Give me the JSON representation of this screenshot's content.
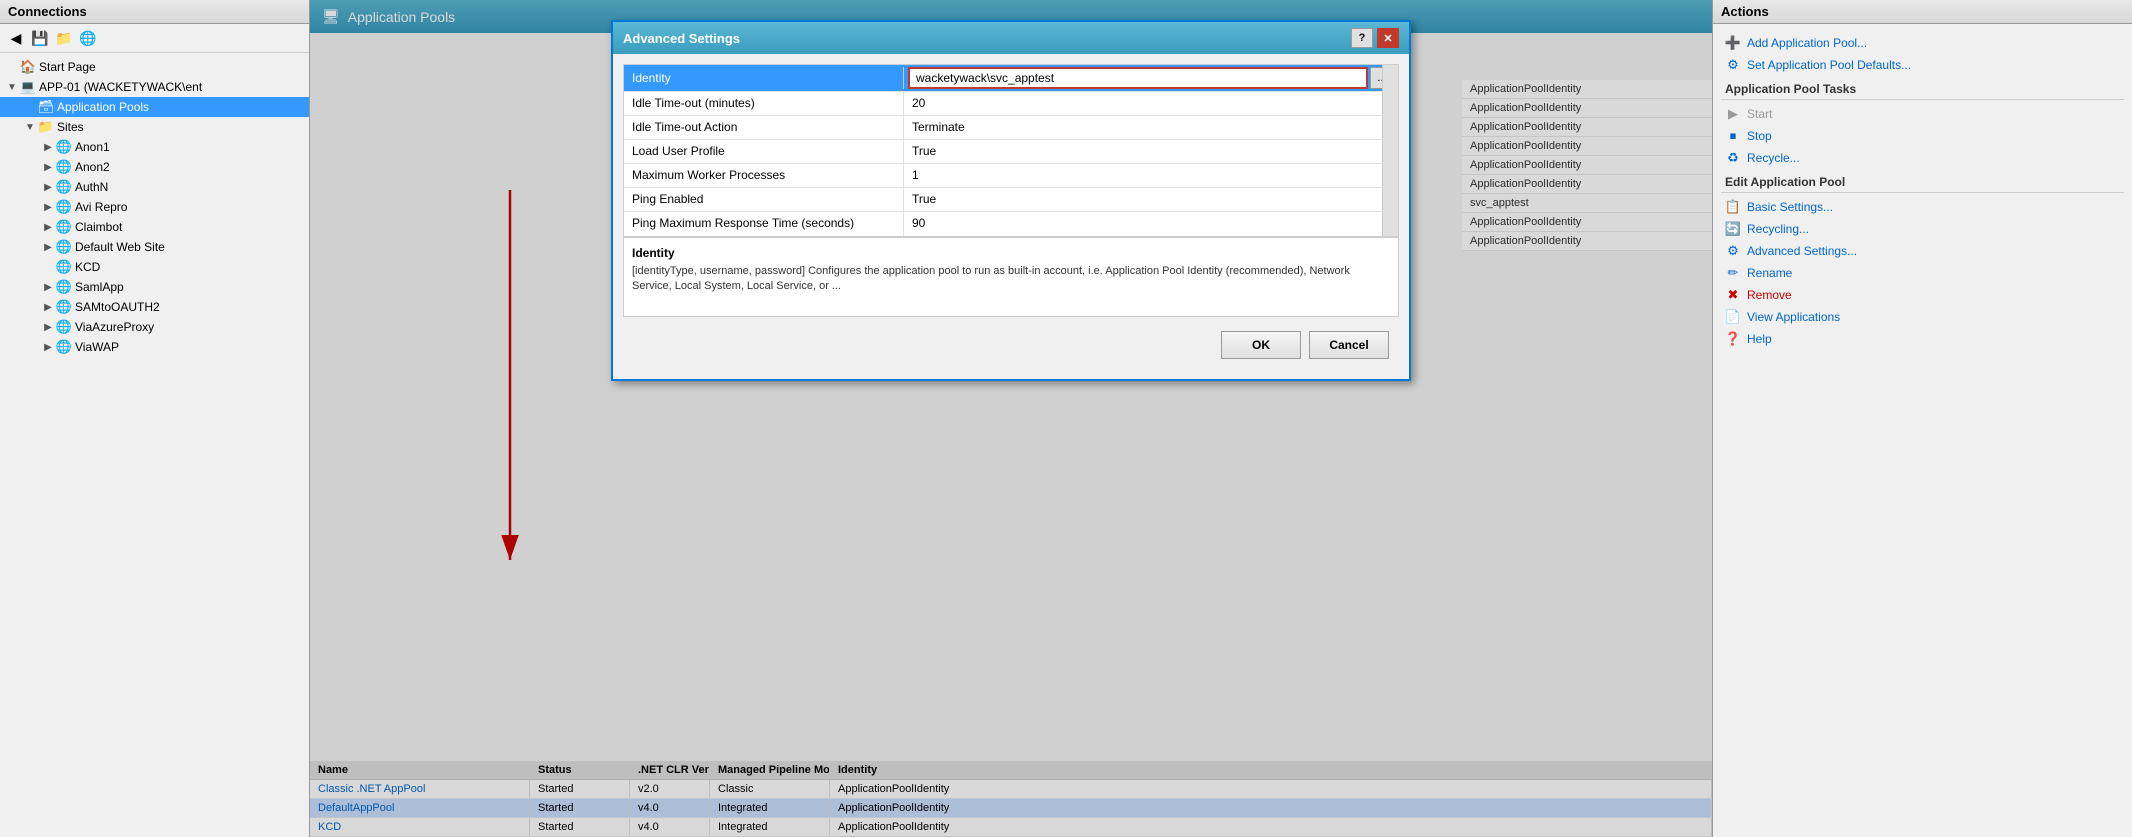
{
  "connections": {
    "header": "Connections",
    "tree": [
      {
        "id": "start-page",
        "label": "Start Page",
        "level": 1,
        "icon": "🏠",
        "expandable": false
      },
      {
        "id": "app01",
        "label": "APP-01 (WACKETYWACK\\ent",
        "level": 1,
        "icon": "💻",
        "expandable": true,
        "expanded": true
      },
      {
        "id": "app-pools",
        "label": "Application Pools",
        "level": 2,
        "icon": "🗃",
        "expandable": false,
        "selected": true
      },
      {
        "id": "sites",
        "label": "Sites",
        "level": 2,
        "icon": "📁",
        "expandable": true,
        "expanded": true
      },
      {
        "id": "anon1",
        "label": "Anon1",
        "level": 3,
        "icon": "🌐",
        "expandable": true
      },
      {
        "id": "anon2",
        "label": "Anon2",
        "level": 3,
        "icon": "🌐",
        "expandable": true
      },
      {
        "id": "authn",
        "label": "AuthN",
        "level": 3,
        "icon": "🌐",
        "expandable": true
      },
      {
        "id": "avi-repro",
        "label": "Avi Repro",
        "level": 3,
        "icon": "🌐",
        "expandable": true
      },
      {
        "id": "claimbot",
        "label": "Claimbot",
        "level": 3,
        "icon": "🌐",
        "expandable": true
      },
      {
        "id": "default-web-site",
        "label": "Default Web Site",
        "level": 3,
        "icon": "🌐",
        "expandable": true
      },
      {
        "id": "kcd",
        "label": "KCD",
        "level": 3,
        "icon": "🌐",
        "expandable": false
      },
      {
        "id": "samlapp",
        "label": "SamlApp",
        "level": 3,
        "icon": "🌐",
        "expandable": true
      },
      {
        "id": "sam-to-oauth2",
        "label": "SAMtoOAUTH2",
        "level": 3,
        "icon": "🌐",
        "expandable": true
      },
      {
        "id": "via-azure-proxy",
        "label": "ViaAzureProxy",
        "level": 3,
        "icon": "🌐",
        "expandable": true
      },
      {
        "id": "via-wap",
        "label": "ViaWAP",
        "level": 3,
        "icon": "🌐",
        "expandable": true
      }
    ]
  },
  "dialog": {
    "title": "Advanced Settings",
    "settings": [
      {
        "label": "Identity",
        "value": "wacketywack\\svc_apptest",
        "selected": true,
        "is_identity": true
      },
      {
        "label": "Idle Time-out (minutes)",
        "value": "20",
        "selected": false
      },
      {
        "label": "Idle Time-out Action",
        "value": "Terminate",
        "selected": false
      },
      {
        "label": "Load User Profile",
        "value": "True",
        "selected": false
      },
      {
        "label": "Maximum Worker Processes",
        "value": "1",
        "selected": false
      },
      {
        "label": "Ping Enabled",
        "value": "True",
        "selected": false
      },
      {
        "label": "Ping Maximum Response Time (seconds)",
        "value": "90",
        "selected": false
      }
    ],
    "description": {
      "title": "Identity",
      "text": "[identityType, username, password] Configures the application pool to run as built-in account, i.e. Application Pool Identity (recommended), Network Service, Local System, Local Service, or ..."
    },
    "ok_label": "OK",
    "cancel_label": "Cancel"
  },
  "background_table": {
    "columns": [
      "Name",
      "Status",
      ".NET CLR Version",
      "Managed Pipeline Mode",
      "Identity"
    ],
    "rows": [
      {
        "name": "Classic .NET AppPool",
        "status": "Started",
        "net_ver": "v2.0",
        "pipeline": "Classic",
        "identity": "ApplicationPoolIdentity"
      },
      {
        "name": "DefaultAppPool",
        "status": "Started",
        "net_ver": "v4.0",
        "pipeline": "Integrated",
        "identity": "ApplicationPoolIdentity",
        "selected": true
      },
      {
        "name": "KCD",
        "status": "Started",
        "net_ver": "v4.0",
        "pipeline": "Integrated",
        "identity": "ApplicationPoolIdentity"
      }
    ],
    "bg_identities": [
      "ApplicationPoolIdentity",
      "ApplicationPoolIdentity",
      "ApplicationPoolIdentity",
      "ApplicationPoolIdentity",
      "ApplicationPoolIdentity",
      "ApplicationPoolIdentity",
      "svc_apptest",
      "ApplicationPoolIdentity",
      "ApplicationPoolIdentity"
    ]
  },
  "actions": {
    "header": "Actions",
    "sections": [
      {
        "title": "",
        "items": [
          {
            "label": "Add Application Pool...",
            "icon": "➕",
            "enabled": true
          },
          {
            "label": "Set Application Pool Defaults...",
            "icon": "⚙",
            "enabled": true
          }
        ]
      },
      {
        "title": "Application Pool Tasks",
        "items": [
          {
            "label": "Start",
            "icon": "▶",
            "enabled": false
          },
          {
            "label": "Stop",
            "icon": "⏹",
            "enabled": true
          },
          {
            "label": "Recycle...",
            "icon": "♻",
            "enabled": true
          }
        ]
      },
      {
        "title": "Edit Application Pool",
        "items": [
          {
            "label": "Basic Settings...",
            "icon": "📋",
            "enabled": true
          },
          {
            "label": "Recycling...",
            "icon": "🔄",
            "enabled": true
          },
          {
            "label": "Advanced Settings...",
            "icon": "⚙",
            "enabled": true
          },
          {
            "label": "Rename",
            "icon": "✏",
            "enabled": true
          },
          {
            "label": "Remove",
            "icon": "✖",
            "enabled": true,
            "color": "red"
          }
        ]
      },
      {
        "title": "",
        "items": [
          {
            "label": "View Applications",
            "icon": "📄",
            "enabled": true
          },
          {
            "label": "Help",
            "icon": "❓",
            "enabled": true
          }
        ]
      }
    ]
  }
}
